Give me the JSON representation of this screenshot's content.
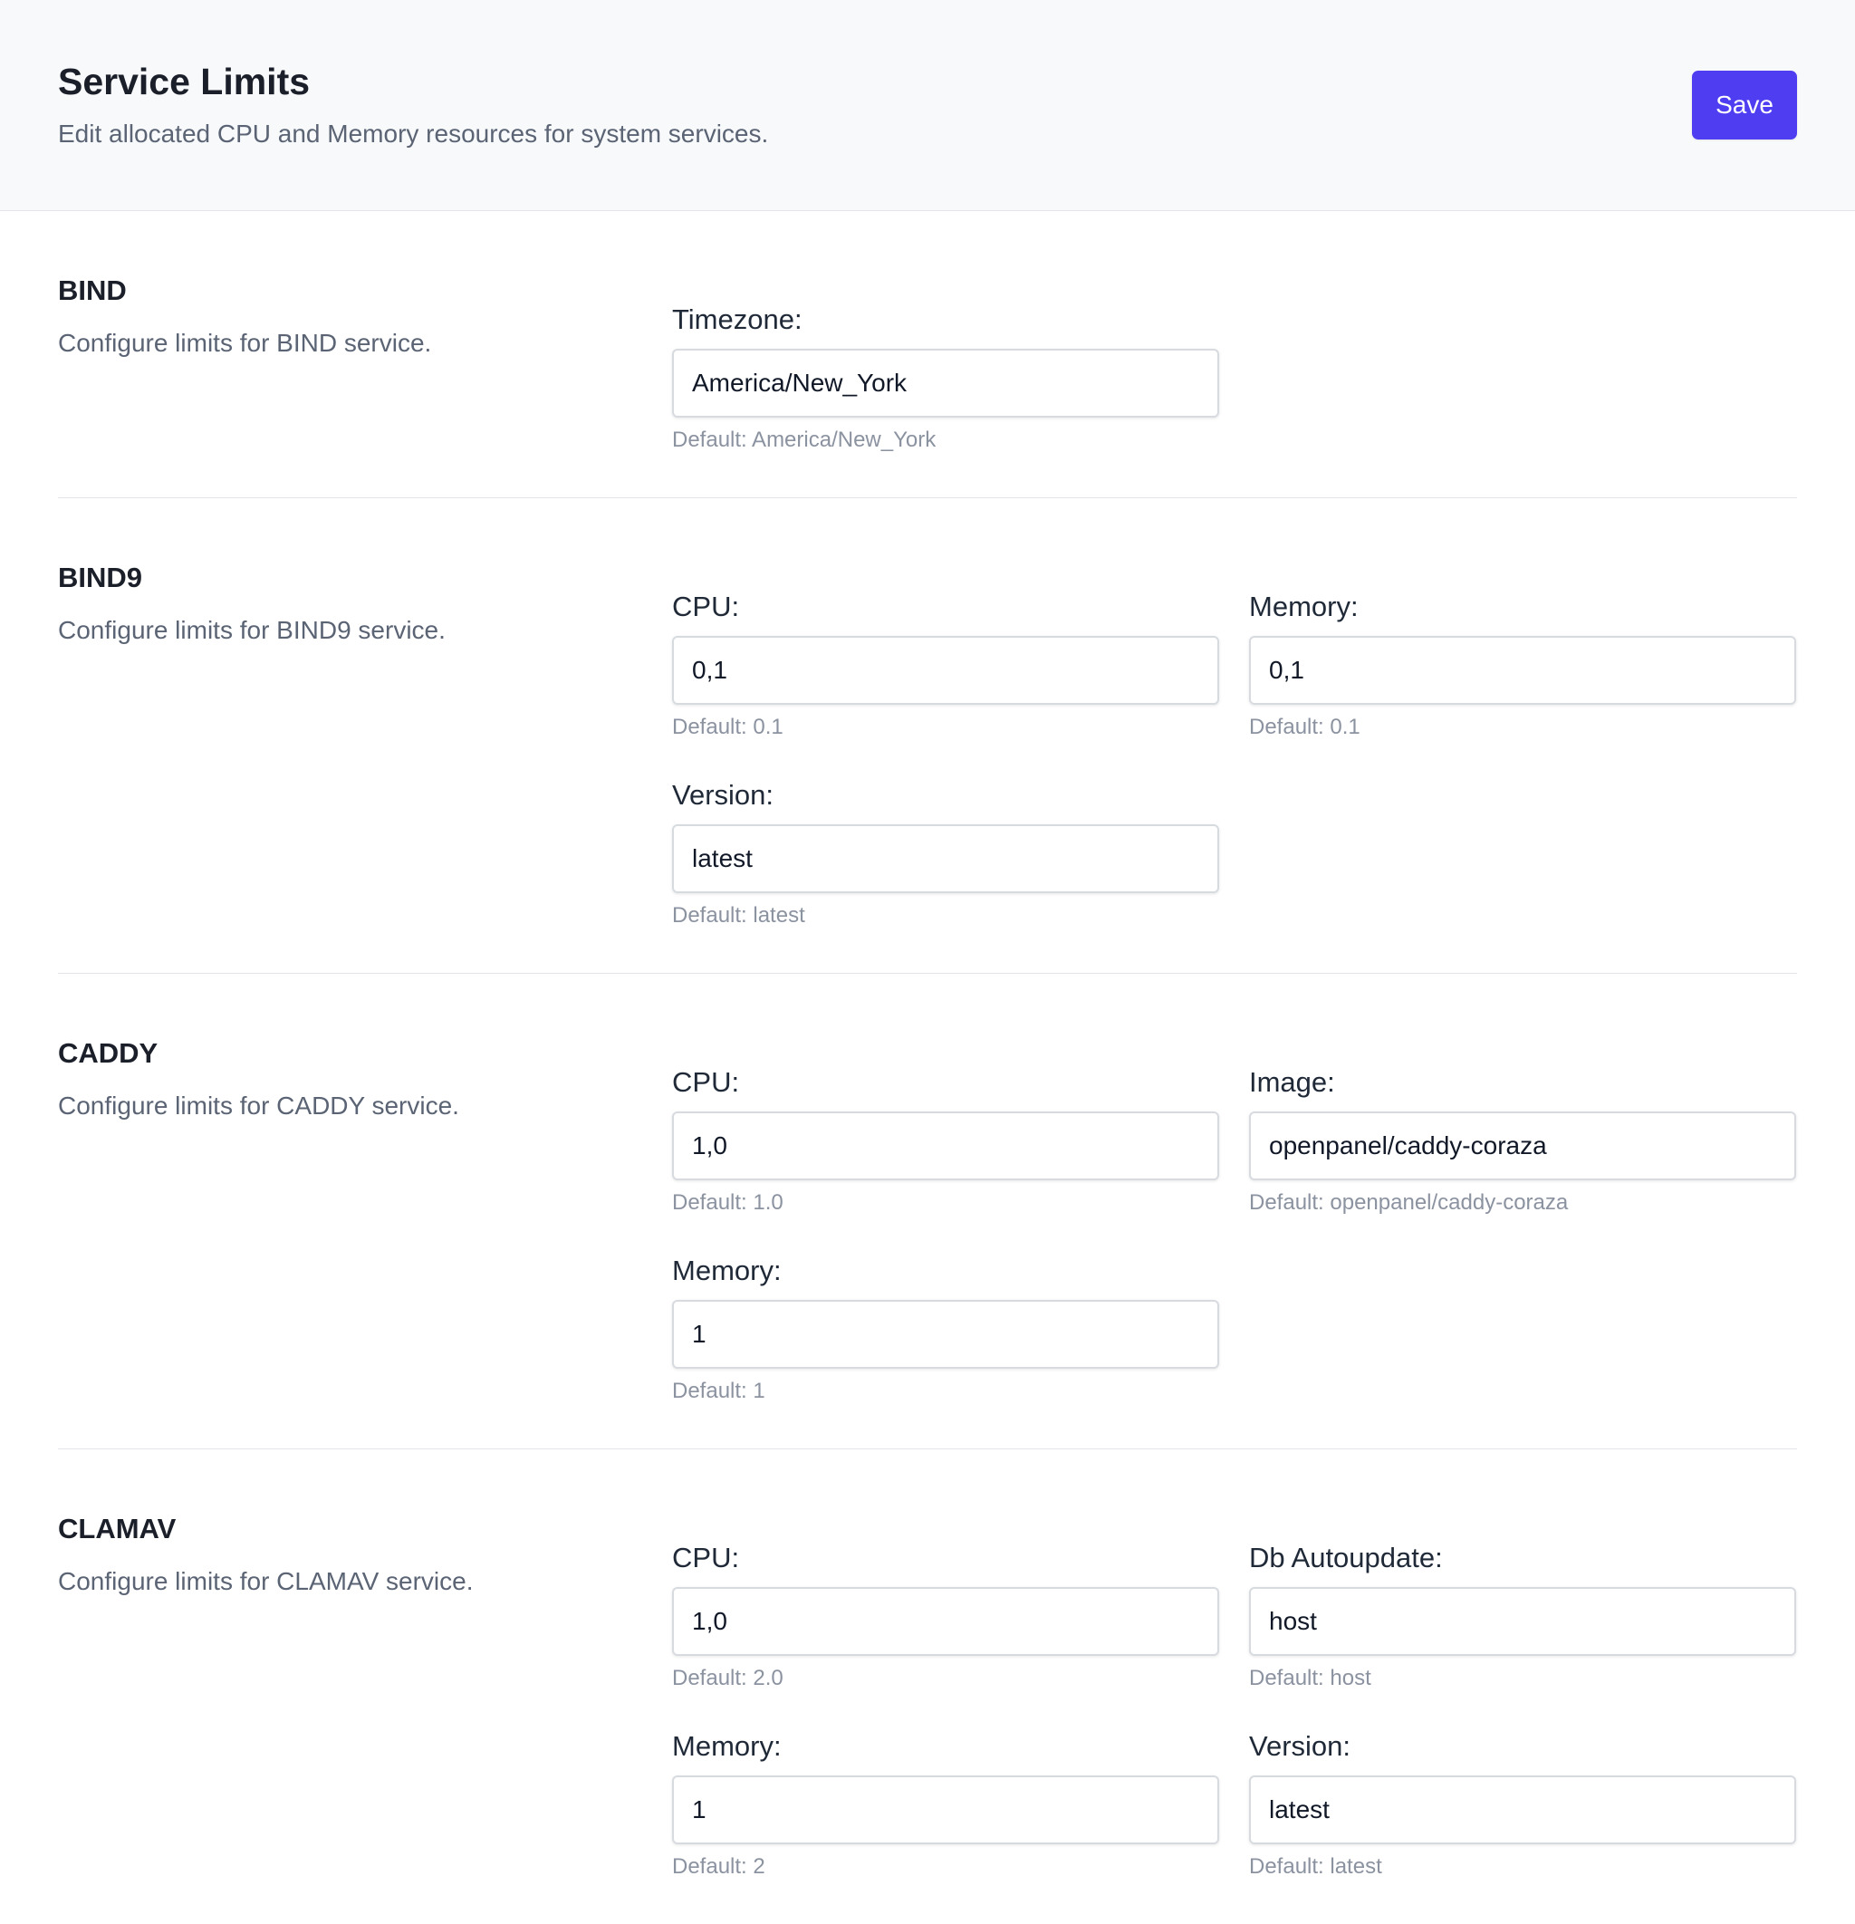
{
  "header": {
    "title": "Service Limits",
    "subtitle": "Edit allocated CPU and Memory resources for system services.",
    "save_label": "Save"
  },
  "services": [
    {
      "name": "BIND",
      "description": "Configure limits for BIND service.",
      "fields": [
        {
          "label": "Timezone:",
          "value": "America/New_York",
          "hint": "Default: America/New_York"
        }
      ]
    },
    {
      "name": "BIND9",
      "description": "Configure limits for BIND9 service.",
      "fields": [
        {
          "label": "CPU:",
          "value": "0,1",
          "hint": "Default: 0.1"
        },
        {
          "label": "Memory:",
          "value": "0,1",
          "hint": "Default: 0.1"
        },
        {
          "label": "Version:",
          "value": "latest",
          "hint": "Default: latest"
        }
      ]
    },
    {
      "name": "CADDY",
      "description": "Configure limits for CADDY service.",
      "fields": [
        {
          "label": "CPU:",
          "value": "1,0",
          "hint": "Default: 1.0"
        },
        {
          "label": "Image:",
          "value": "openpanel/caddy-coraza",
          "hint": "Default: openpanel/caddy-coraza"
        },
        {
          "label": "Memory:",
          "value": "1",
          "hint": "Default: 1"
        }
      ]
    },
    {
      "name": "CLAMAV",
      "description": "Configure limits for CLAMAV service.",
      "fields": [
        {
          "label": "CPU:",
          "value": "1,0",
          "hint": "Default: 2.0"
        },
        {
          "label": "Db Autoupdate:",
          "value": "host",
          "hint": "Default: host"
        },
        {
          "label": "Memory:",
          "value": "1",
          "hint": "Default: 2"
        },
        {
          "label": "Version:",
          "value": "latest",
          "hint": "Default: latest"
        }
      ]
    }
  ]
}
